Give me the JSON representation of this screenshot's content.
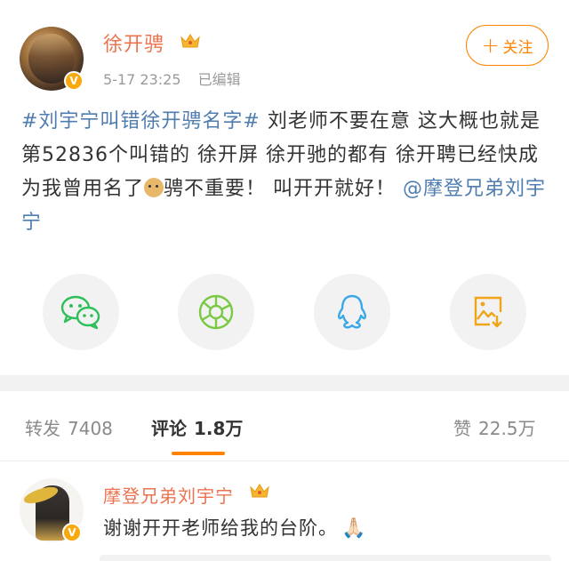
{
  "post": {
    "author": "徐开骋",
    "time": "5-17 23:25",
    "edited": "已编辑",
    "follow_label": "关注",
    "text": {
      "topic": "#刘宇宁叫错徐开骋名字#",
      "body1": " 刘老师不要在意 这大概也就是第52836个叫错的 徐开屏 徐开驰的都有 徐开聘已经快成为我曾用名了",
      "body2": "骋不重要！ 叫开开就好！",
      "mention": "@摩登兄弟刘宇宁"
    }
  },
  "share": {
    "items": [
      "wechat-icon",
      "moments-icon",
      "qq-icon",
      "save-image-icon"
    ],
    "colors": {
      "wechat": "#2fbf5a",
      "moments": "#7ac943",
      "qq": "#3aa8e8",
      "save": "#f0a418"
    }
  },
  "tabs": {
    "repost_label": "转发",
    "repost_count": "7408",
    "comment_label": "评论",
    "comment_count": "1.8万",
    "like_label": "赞",
    "like_count": "22.5万"
  },
  "comment": {
    "author": "摩登兄弟刘宇宁",
    "text": "谢谢开开老师给我的台阶。",
    "emoji": "🙏🏻"
  },
  "colors": {
    "accent": "#ff8200",
    "name": "#eb7350",
    "link": "#507daf",
    "badge": "#f7a90e"
  }
}
